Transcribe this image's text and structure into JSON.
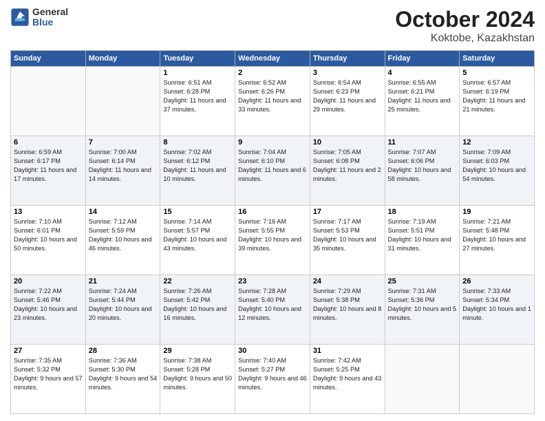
{
  "header": {
    "logo_line1": "General",
    "logo_line2": "Blue",
    "month_year": "October 2024",
    "location": "Koktobe, Kazakhstan"
  },
  "weekdays": [
    "Sunday",
    "Monday",
    "Tuesday",
    "Wednesday",
    "Thursday",
    "Friday",
    "Saturday"
  ],
  "weeks": [
    [
      {
        "day": "",
        "info": ""
      },
      {
        "day": "",
        "info": ""
      },
      {
        "day": "1",
        "info": "Sunrise: 6:51 AM\nSunset: 6:28 PM\nDaylight: 11 hours and 37 minutes."
      },
      {
        "day": "2",
        "info": "Sunrise: 6:52 AM\nSunset: 6:26 PM\nDaylight: 11 hours and 33 minutes."
      },
      {
        "day": "3",
        "info": "Sunrise: 6:54 AM\nSunset: 6:23 PM\nDaylight: 11 hours and 29 minutes."
      },
      {
        "day": "4",
        "info": "Sunrise: 6:55 AM\nSunset: 6:21 PM\nDaylight: 11 hours and 25 minutes."
      },
      {
        "day": "5",
        "info": "Sunrise: 6:57 AM\nSunset: 6:19 PM\nDaylight: 11 hours and 21 minutes."
      }
    ],
    [
      {
        "day": "6",
        "info": "Sunrise: 6:59 AM\nSunset: 6:17 PM\nDaylight: 11 hours and 17 minutes."
      },
      {
        "day": "7",
        "info": "Sunrise: 7:00 AM\nSunset: 6:14 PM\nDaylight: 11 hours and 14 minutes."
      },
      {
        "day": "8",
        "info": "Sunrise: 7:02 AM\nSunset: 6:12 PM\nDaylight: 11 hours and 10 minutes."
      },
      {
        "day": "9",
        "info": "Sunrise: 7:04 AM\nSunset: 6:10 PM\nDaylight: 11 hours and 6 minutes."
      },
      {
        "day": "10",
        "info": "Sunrise: 7:05 AM\nSunset: 6:08 PM\nDaylight: 11 hours and 2 minutes."
      },
      {
        "day": "11",
        "info": "Sunrise: 7:07 AM\nSunset: 6:06 PM\nDaylight: 10 hours and 58 minutes."
      },
      {
        "day": "12",
        "info": "Sunrise: 7:09 AM\nSunset: 6:03 PM\nDaylight: 10 hours and 54 minutes."
      }
    ],
    [
      {
        "day": "13",
        "info": "Sunrise: 7:10 AM\nSunset: 6:01 PM\nDaylight: 10 hours and 50 minutes."
      },
      {
        "day": "14",
        "info": "Sunrise: 7:12 AM\nSunset: 5:59 PM\nDaylight: 10 hours and 46 minutes."
      },
      {
        "day": "15",
        "info": "Sunrise: 7:14 AM\nSunset: 5:57 PM\nDaylight: 10 hours and 43 minutes."
      },
      {
        "day": "16",
        "info": "Sunrise: 7:16 AM\nSunset: 5:55 PM\nDaylight: 10 hours and 39 minutes."
      },
      {
        "day": "17",
        "info": "Sunrise: 7:17 AM\nSunset: 5:53 PM\nDaylight: 10 hours and 35 minutes."
      },
      {
        "day": "18",
        "info": "Sunrise: 7:19 AM\nSunset: 5:51 PM\nDaylight: 10 hours and 31 minutes."
      },
      {
        "day": "19",
        "info": "Sunrise: 7:21 AM\nSunset: 5:48 PM\nDaylight: 10 hours and 27 minutes."
      }
    ],
    [
      {
        "day": "20",
        "info": "Sunrise: 7:22 AM\nSunset: 5:46 PM\nDaylight: 10 hours and 23 minutes."
      },
      {
        "day": "21",
        "info": "Sunrise: 7:24 AM\nSunset: 5:44 PM\nDaylight: 10 hours and 20 minutes."
      },
      {
        "day": "22",
        "info": "Sunrise: 7:26 AM\nSunset: 5:42 PM\nDaylight: 10 hours and 16 minutes."
      },
      {
        "day": "23",
        "info": "Sunrise: 7:28 AM\nSunset: 5:40 PM\nDaylight: 10 hours and 12 minutes."
      },
      {
        "day": "24",
        "info": "Sunrise: 7:29 AM\nSunset: 5:38 PM\nDaylight: 10 hours and 8 minutes."
      },
      {
        "day": "25",
        "info": "Sunrise: 7:31 AM\nSunset: 5:36 PM\nDaylight: 10 hours and 5 minutes."
      },
      {
        "day": "26",
        "info": "Sunrise: 7:33 AM\nSunset: 5:34 PM\nDaylight: 10 hours and 1 minute."
      }
    ],
    [
      {
        "day": "27",
        "info": "Sunrise: 7:35 AM\nSunset: 5:32 PM\nDaylight: 9 hours and 57 minutes."
      },
      {
        "day": "28",
        "info": "Sunrise: 7:36 AM\nSunset: 5:30 PM\nDaylight: 9 hours and 54 minutes."
      },
      {
        "day": "29",
        "info": "Sunrise: 7:38 AM\nSunset: 5:28 PM\nDaylight: 9 hours and 50 minutes."
      },
      {
        "day": "30",
        "info": "Sunrise: 7:40 AM\nSunset: 5:27 PM\nDaylight: 9 hours and 46 minutes."
      },
      {
        "day": "31",
        "info": "Sunrise: 7:42 AM\nSunset: 5:25 PM\nDaylight: 9 hours and 43 minutes."
      },
      {
        "day": "",
        "info": ""
      },
      {
        "day": "",
        "info": ""
      }
    ]
  ]
}
